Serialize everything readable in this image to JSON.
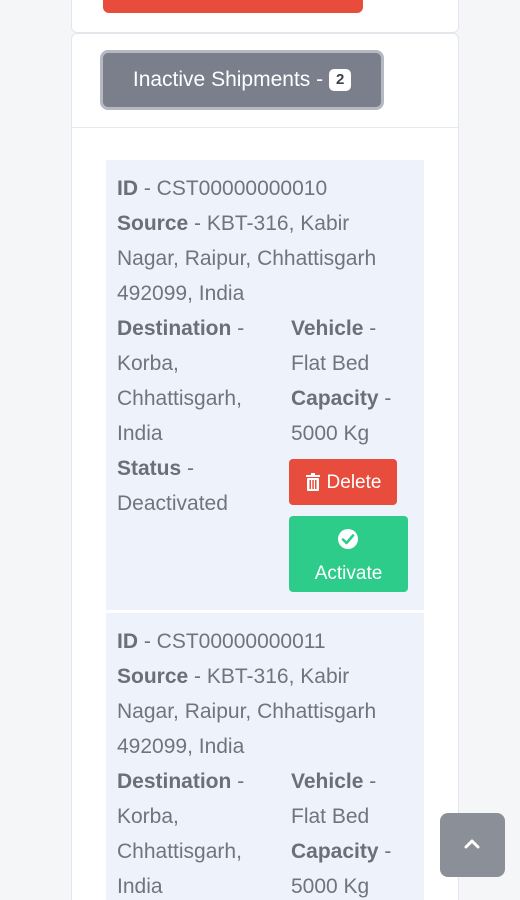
{
  "inactive_header": {
    "label": "Inactive Shipments -",
    "count": "2"
  },
  "shipments": [
    {
      "id_label": "ID",
      "id_value": "- CST00000000010",
      "source_label": "Source",
      "source_line1": "- KBT-316, Kabir",
      "source_line2": "Nagar, Raipur, Chhattisgarh",
      "source_line3": "492099, India",
      "destination_label": "Destination",
      "destination_sep": "-",
      "destination_line1": "Korba,",
      "destination_line2": "Chhattisgarh,",
      "destination_line3": "India",
      "vehicle_label": "Vehicle",
      "vehicle_sep": "-",
      "vehicle_value": "Flat Bed",
      "capacity_label": "Capacity",
      "capacity_sep": "-",
      "capacity_value": "5000 Kg",
      "status_label": "Status",
      "status_sep": "-",
      "status_value": "Deactivated",
      "delete_label": "Delete",
      "activate_label": "Activate"
    },
    {
      "id_label": "ID",
      "id_value": "- CST00000000011",
      "source_label": "Source",
      "source_line1": "- KBT-316, Kabir",
      "source_line2": "Nagar, Raipur, Chhattisgarh",
      "source_line3": "492099, India",
      "destination_label": "Destination",
      "destination_sep": "-",
      "destination_line1": "Korba,",
      "destination_line2": "Chhattisgarh,",
      "destination_line3": "India",
      "vehicle_label": "Vehicle",
      "vehicle_sep": "-",
      "vehicle_value": "Flat Bed",
      "capacity_label": "Capacity",
      "capacity_sep": "-",
      "capacity_value": "5000 Kg"
    }
  ],
  "icons": {
    "delete": "trash-icon",
    "activate": "check-circle-icon",
    "scroll_top": "chevron-up-icon"
  },
  "colors": {
    "delete": "#e74c3c",
    "activate": "#2ecc8a",
    "header_button": "#7a7f8b",
    "shipment_bg": "#eef3fb"
  }
}
